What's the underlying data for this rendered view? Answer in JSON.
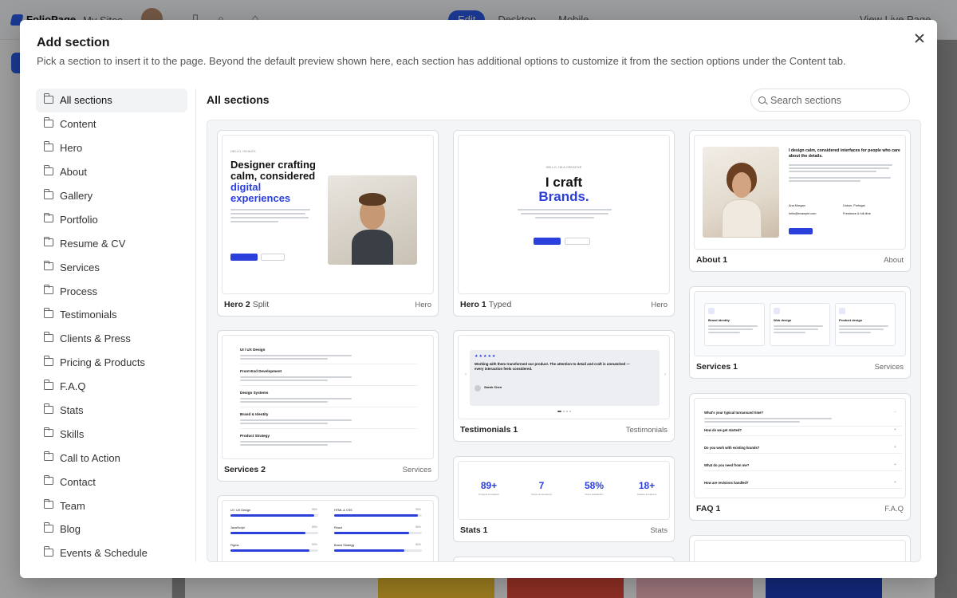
{
  "app": {
    "logo_text": "FolioPage",
    "sites_label": "My Sites",
    "modes": [
      {
        "label": "Edit",
        "active": true
      },
      {
        "label": "Desktop",
        "active": false
      },
      {
        "label": "Mobile",
        "active": false
      }
    ],
    "view_live_label": "View Live Page",
    "accent_color": "#2b5ce6"
  },
  "modal": {
    "title": "Add section",
    "subtitle": "Pick a section to insert it to the page. Beyond the default preview shown here, each section has additional options to customize it from the section options under the Content tab.",
    "close_icon": "close-icon",
    "categories": [
      {
        "label": "All sections",
        "active": true
      },
      {
        "label": "Content"
      },
      {
        "label": "Hero"
      },
      {
        "label": "About"
      },
      {
        "label": "Gallery"
      },
      {
        "label": "Portfolio"
      },
      {
        "label": "Resume & CV"
      },
      {
        "label": "Services"
      },
      {
        "label": "Process"
      },
      {
        "label": "Testimonials"
      },
      {
        "label": "Clients & Press"
      },
      {
        "label": "Pricing & Products"
      },
      {
        "label": "F.A.Q"
      },
      {
        "label": "Stats"
      },
      {
        "label": "Skills"
      },
      {
        "label": "Call to Action"
      },
      {
        "label": "Contact"
      },
      {
        "label": "Team"
      },
      {
        "label": "Blog"
      },
      {
        "label": "Events & Schedule"
      }
    ],
    "section_heading": "All sections",
    "search_placeholder": "Search sections",
    "cards": {
      "hero2": {
        "name": "Hero 2",
        "variant": "Split",
        "category": "Hero",
        "kicker": "HELLO, I'M ALEX",
        "headline_1": "Designer crafting",
        "headline_2": "calm, considered",
        "headline_accent": "digital",
        "headline_accent_2": "experiences",
        "btn_primary": "View my work",
        "btn_secondary": "Get in touch"
      },
      "hero1": {
        "name": "Hero 1",
        "variant": "Typed",
        "category": "Hero",
        "kicker": "HELLO, I'M A CREATIVE",
        "headline_1": "I craft",
        "headline_2": "Brands.",
        "btn_primary": "View my work",
        "btn_secondary": "Get in touch"
      },
      "about1": {
        "name": "About 1",
        "variant": "",
        "category": "About",
        "headline": "I design calm, considered interfaces for people who care about the details.",
        "name_value": "Ana Morgan",
        "location_value": "Lisbon, Portugal",
        "email_value": "hello@example.com",
        "availability_value": "Freelance & full-time",
        "btn": "Download CV"
      },
      "services2": {
        "name": "Services 2",
        "variant": "",
        "category": "Services",
        "items": [
          "UI / UX Design",
          "Front-End Development",
          "Design Systems",
          "Brand & Identity",
          "Product Strategy"
        ]
      },
      "testimonials1": {
        "name": "Testimonials 1",
        "variant": "",
        "category": "Testimonials",
        "stars": "★★★★★",
        "quote": "Working with them transformed our product. The attention to detail and craft is unmatched — every interaction feels considered.",
        "author": "Sarah Chen"
      },
      "services1": {
        "name": "Services 1",
        "variant": "",
        "category": "Services",
        "items": [
          "Brand identity",
          "Web design",
          "Product design"
        ]
      },
      "stats1": {
        "name": "Stats 1",
        "variant": "",
        "category": "Stats",
        "stats": [
          {
            "value": "89+",
            "label": "Projects completed"
          },
          {
            "value": "7",
            "label": "Years of experience"
          },
          {
            "value": "58%",
            "label": "Client satisfaction"
          },
          {
            "value": "18+",
            "label": "Awards & features"
          }
        ]
      },
      "faq1": {
        "name": "FAQ 1",
        "variant": "",
        "category": "F.A.Q",
        "questions": [
          "What's your typical turnaround time?",
          "How do we get started?",
          "Do you work with existing brands?",
          "What do you need from me?",
          "How are revisions handled?"
        ]
      },
      "skills": {
        "items": [
          {
            "label": "UI / UX Design",
            "level": 0.95
          },
          {
            "label": "HTML & CSS",
            "level": 0.95
          },
          {
            "label": "JavaScript",
            "level": 0.85
          },
          {
            "label": "React",
            "level": 0.85
          },
          {
            "label": "Figma",
            "level": 0.9
          },
          {
            "label": "Brand Strategy",
            "level": 0.8
          }
        ]
      }
    }
  }
}
